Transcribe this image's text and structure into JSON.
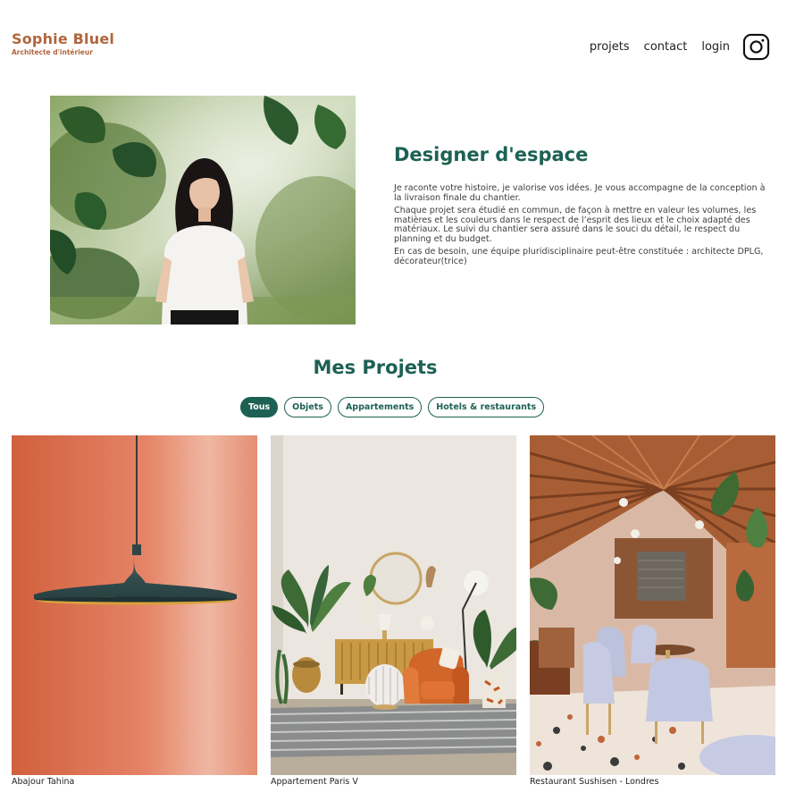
{
  "header": {
    "logo_name": "Sophie Bluel",
    "logo_subtitle": "Architecte d'intérieur",
    "nav": {
      "projects": "projets",
      "contact": "contact",
      "login": "login"
    },
    "instagram_icon": "instagram-icon"
  },
  "intro": {
    "title": "Designer d'espace",
    "paragraphs": [
      "Je raconte votre histoire, je valorise vos idées. Je vous accompagne de la conception à la livraison finale du chantier.",
      "Chaque projet sera étudié en commun, de façon à mettre en valeur les volumes, les matières et les couleurs dans le respect de l’esprit des lieux et le choix adapté des matériaux. Le suivi du chantier sera assuré dans le souci du détail, le respect du planning et du budget.",
      "En cas de besoin, une équipe pluridisciplinaire peut-être constituée : architecte DPLG, décorateur(trice)"
    ]
  },
  "portfolio": {
    "title": "Mes Projets",
    "filters": [
      "Tous",
      "Objets",
      "Appartements",
      "Hotels & restaurants"
    ],
    "active_filter": "Tous",
    "works": [
      {
        "caption": "Abajour Tahina"
      },
      {
        "caption": "Appartement Paris V"
      },
      {
        "caption": "Restaurant Sushisen - Londres"
      }
    ]
  },
  "colors": {
    "brand": "#b1663c",
    "accent": "#1d6154",
    "text": "#3d3d3d",
    "background": "#ffffff"
  }
}
